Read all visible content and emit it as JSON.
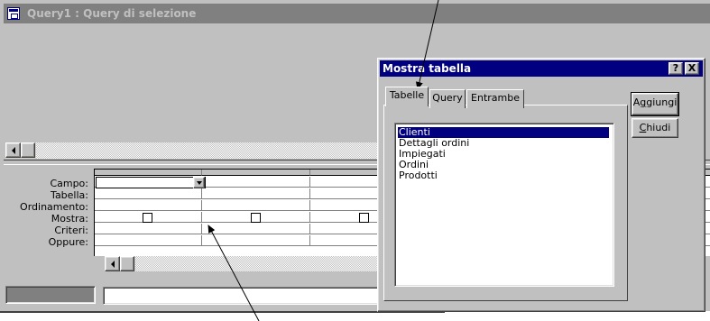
{
  "query_window": {
    "title": "Query1 : Query di selezione",
    "row_labels": [
      "Campo:",
      "Tabella:",
      "Ordinamento:",
      "Mostra:",
      "Criteri:",
      "Oppure:"
    ]
  },
  "dialog": {
    "title": "Mostra tabella",
    "help_button": "?",
    "close_button": "X",
    "tabs": [
      "Tabelle",
      "Query",
      "Entrambe"
    ],
    "active_tab": "Tabelle",
    "tables": [
      "Clienti",
      "Dettagli ordini",
      "Impiegati",
      "Ordini",
      "Prodotti"
    ],
    "selected_table": "Clienti",
    "add_button": "Aggiungi",
    "close_label": "Chiudi"
  },
  "icons": [
    "query-window-icon",
    "scroll-left-arrow-icon",
    "combo-dropdown-arrow-icon",
    "show-checkbox-icon",
    "help-icon",
    "close-icon"
  ],
  "colors": {
    "window_bg": "#c0c0c0",
    "inactive_title": "#808080",
    "active_title": "#000080",
    "selection": "#000080"
  }
}
